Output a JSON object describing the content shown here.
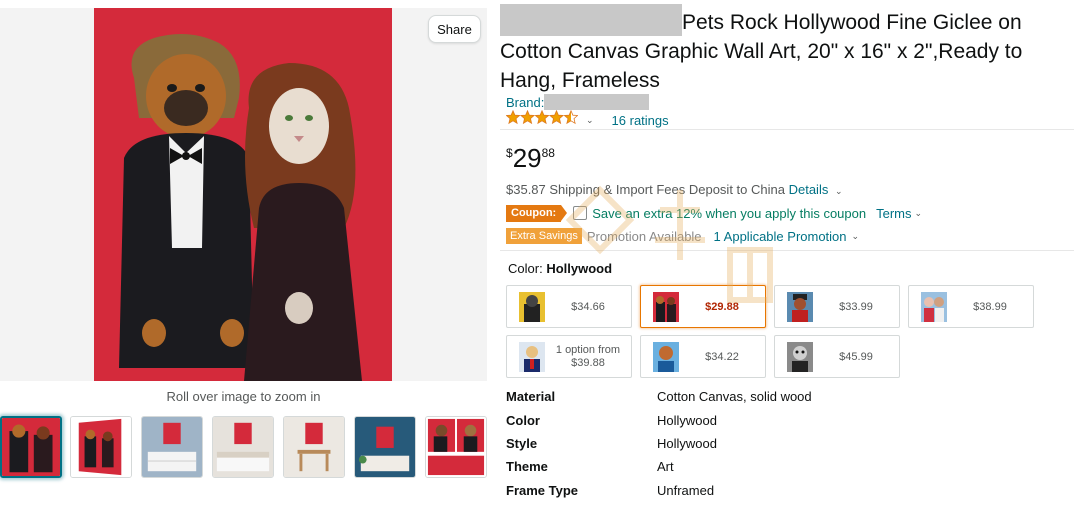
{
  "gallery": {
    "share_label": "Share",
    "zoom_hint": "Roll over image to zoom in",
    "thumbnail_count": 7
  },
  "product": {
    "title": "Pets Rock Hollywood Fine Giclee on Cotton Canvas Graphic Wall Art, 20\" x 16\" x 2\",Ready to Hang, Frameless",
    "brand_label": "Brand:",
    "rating_value": 4.5,
    "ratings_count": "16 ratings",
    "price_symbol": "$",
    "price_whole": "29",
    "price_fraction": "88",
    "shipping_amount": "$35.87",
    "shipping_text": "Shipping & Import Fees Deposit to China",
    "shipping_details": "Details",
    "coupon_badge": "Coupon:",
    "coupon_text": "Save an extra 12% when you apply this coupon",
    "coupon_terms": "Terms",
    "extra_savings_badge": "Extra Savings",
    "promotion_available": "Promotion Available",
    "applicable_promotion": "1 Applicable Promotion",
    "color_label": "Color:",
    "color_value": "Hollywood"
  },
  "swatches": [
    {
      "price": "$34.66",
      "selected": false
    },
    {
      "price": "$29.88",
      "selected": true
    },
    {
      "price": "$33.99",
      "selected": false
    },
    {
      "price": "$38.99",
      "selected": false
    },
    {
      "line1": "1 option from",
      "line2": "$39.88",
      "selected": false
    },
    {
      "price": "$34.22",
      "selected": false
    },
    {
      "price": "$45.99",
      "selected": false
    }
  ],
  "specs": [
    {
      "key": "Material",
      "value": "Cotton Canvas, solid wood"
    },
    {
      "key": "Color",
      "value": "Hollywood"
    },
    {
      "key": "Style",
      "value": "Hollywood"
    },
    {
      "key": "Theme",
      "value": "Art"
    },
    {
      "key": "Frame Type",
      "value": "Unframed"
    }
  ],
  "colors": {
    "link": "#007185",
    "coupon_orange": "#e47911",
    "price_red": "#b12704",
    "canvas_red": "#d42a3b"
  }
}
